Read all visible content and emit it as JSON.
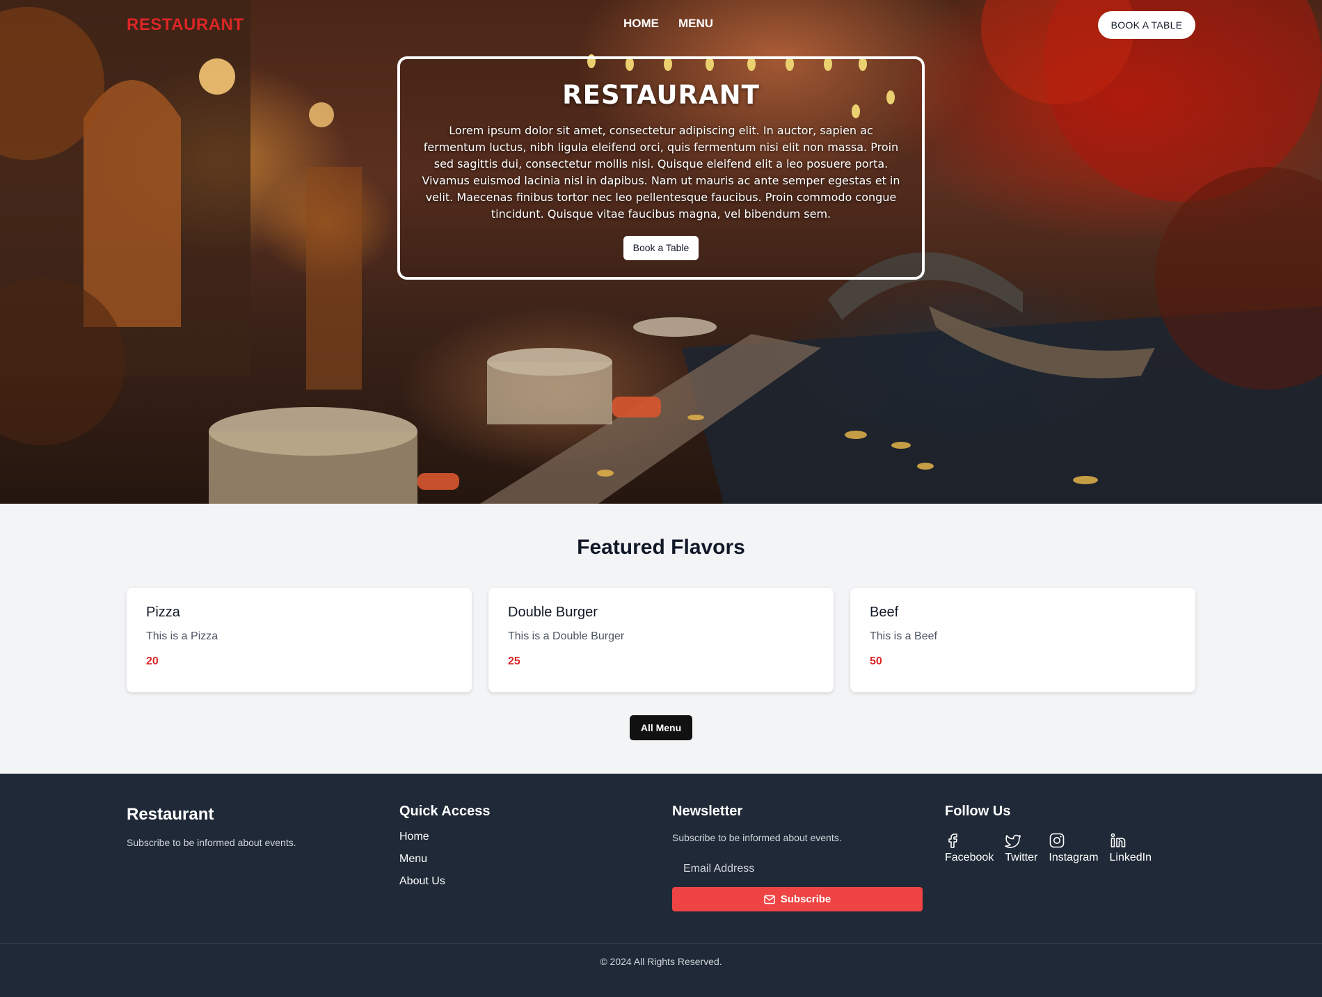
{
  "nav": {
    "logo": "RESTAURANT",
    "links": [
      "HOME",
      "MENU"
    ],
    "cta": "BOOK A TABLE"
  },
  "hero": {
    "title": "RESTAURANT",
    "text": "Lorem ipsum dolor sit amet, consectetur adipiscing elit. In auctor, sapien ac fermentum luctus, nibh ligula eleifend orci, quis fermentum nisi elit non massa. Proin sed sagittis dui, consectetur mollis nisi. Quisque eleifend elit a leo posuere porta. Vivamus euismod lacinia nisl in dapibus. Nam ut mauris ac ante semper egestas et in velit. Maecenas finibus tortor nec leo pellentesque faucibus. Proin commodo congue tincidunt. Quisque vitae faucibus magna, vel bibendum sem.",
    "button": "Book a Table"
  },
  "featured": {
    "title": "Featured Flavors",
    "items": [
      {
        "name": "Pizza",
        "description": "This is a Pizza",
        "price": "20"
      },
      {
        "name": "Double Burger",
        "description": "This is a Double Burger",
        "price": "25"
      },
      {
        "name": "Beef",
        "description": "This is a Beef",
        "price": "50"
      }
    ],
    "all_menu": "All Menu"
  },
  "footer": {
    "brand": "Restaurant",
    "brand_sub": "Subscribe to be informed about events.",
    "quick_access": {
      "title": "Quick Access",
      "links": [
        "Home",
        "Menu",
        "About Us"
      ]
    },
    "newsletter": {
      "title": "Newsletter",
      "sub": "Subscribe to be informed about events.",
      "placeholder": "Email Address",
      "button": "Subscribe"
    },
    "follow": {
      "title": "Follow Us",
      "items": [
        {
          "label": "Facebook",
          "icon": "facebook-icon"
        },
        {
          "label": "Twitter",
          "icon": "twitter-icon"
        },
        {
          "label": "Instagram",
          "icon": "instagram-icon"
        },
        {
          "label": "LinkedIn",
          "icon": "linkedin-icon"
        }
      ]
    },
    "copyright": "© 2024 All Rights Reserved."
  },
  "colors": {
    "accent": "#dc2626",
    "subscribe": "#ef4444",
    "footer_bg": "#1f2937",
    "page_bg": "#f3f4f6"
  }
}
